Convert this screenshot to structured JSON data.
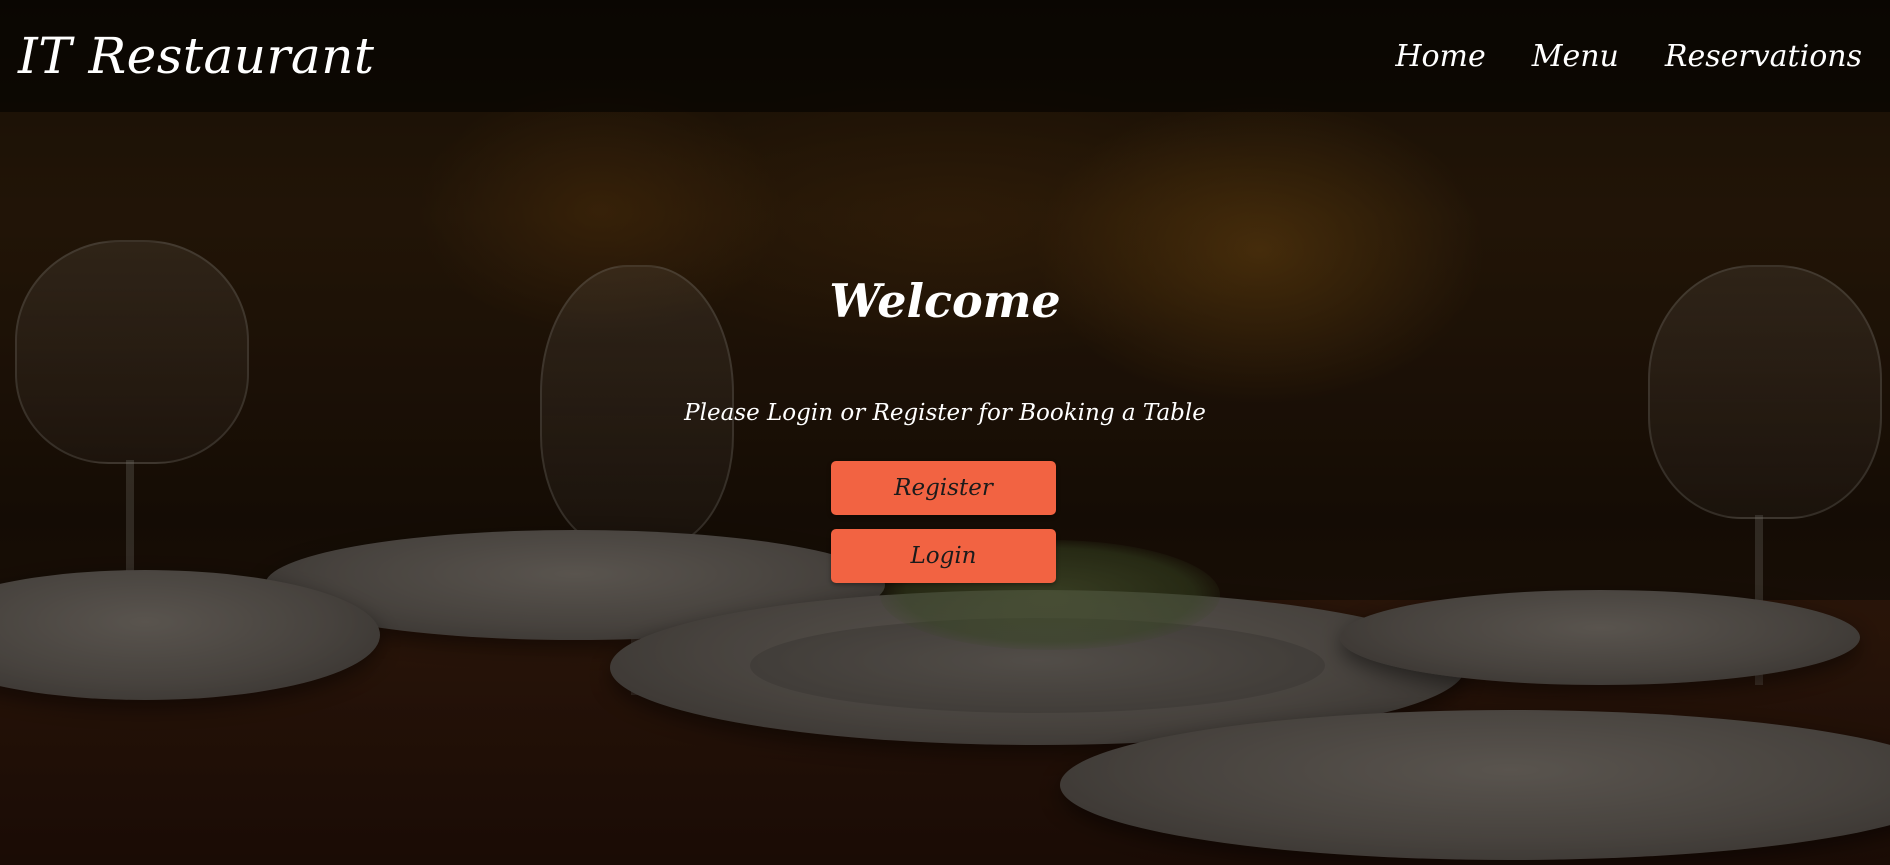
{
  "brand": {
    "title": "IT Restaurant"
  },
  "nav": {
    "items": [
      {
        "label": "Home"
      },
      {
        "label": "Menu"
      },
      {
        "label": "Reservations"
      }
    ]
  },
  "hero": {
    "title": "Welcome",
    "subtitle": "Please Login or Register for Booking a Table",
    "register_label": "Register",
    "login_label": "Login"
  },
  "colors": {
    "button": "#f26342",
    "nav_background": "rgba(0,0,0,0.55)"
  }
}
